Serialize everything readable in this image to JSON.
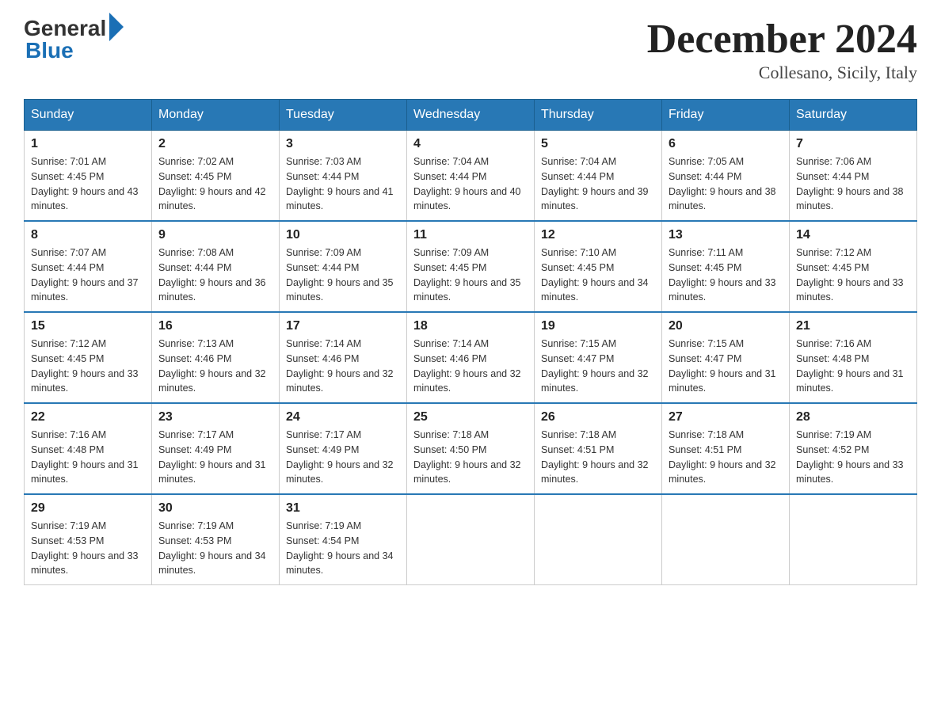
{
  "header": {
    "logo_general": "General",
    "logo_blue": "Blue",
    "month_title": "December 2024",
    "location": "Collesano, Sicily, Italy"
  },
  "days_of_week": [
    "Sunday",
    "Monday",
    "Tuesday",
    "Wednesday",
    "Thursday",
    "Friday",
    "Saturday"
  ],
  "weeks": [
    [
      {
        "day": "1",
        "sunrise": "7:01 AM",
        "sunset": "4:45 PM",
        "daylight": "9 hours and 43 minutes."
      },
      {
        "day": "2",
        "sunrise": "7:02 AM",
        "sunset": "4:45 PM",
        "daylight": "9 hours and 42 minutes."
      },
      {
        "day": "3",
        "sunrise": "7:03 AM",
        "sunset": "4:44 PM",
        "daylight": "9 hours and 41 minutes."
      },
      {
        "day": "4",
        "sunrise": "7:04 AM",
        "sunset": "4:44 PM",
        "daylight": "9 hours and 40 minutes."
      },
      {
        "day": "5",
        "sunrise": "7:04 AM",
        "sunset": "4:44 PM",
        "daylight": "9 hours and 39 minutes."
      },
      {
        "day": "6",
        "sunrise": "7:05 AM",
        "sunset": "4:44 PM",
        "daylight": "9 hours and 38 minutes."
      },
      {
        "day": "7",
        "sunrise": "7:06 AM",
        "sunset": "4:44 PM",
        "daylight": "9 hours and 38 minutes."
      }
    ],
    [
      {
        "day": "8",
        "sunrise": "7:07 AM",
        "sunset": "4:44 PM",
        "daylight": "9 hours and 37 minutes."
      },
      {
        "day": "9",
        "sunrise": "7:08 AM",
        "sunset": "4:44 PM",
        "daylight": "9 hours and 36 minutes."
      },
      {
        "day": "10",
        "sunrise": "7:09 AM",
        "sunset": "4:44 PM",
        "daylight": "9 hours and 35 minutes."
      },
      {
        "day": "11",
        "sunrise": "7:09 AM",
        "sunset": "4:45 PM",
        "daylight": "9 hours and 35 minutes."
      },
      {
        "day": "12",
        "sunrise": "7:10 AM",
        "sunset": "4:45 PM",
        "daylight": "9 hours and 34 minutes."
      },
      {
        "day": "13",
        "sunrise": "7:11 AM",
        "sunset": "4:45 PM",
        "daylight": "9 hours and 33 minutes."
      },
      {
        "day": "14",
        "sunrise": "7:12 AM",
        "sunset": "4:45 PM",
        "daylight": "9 hours and 33 minutes."
      }
    ],
    [
      {
        "day": "15",
        "sunrise": "7:12 AM",
        "sunset": "4:45 PM",
        "daylight": "9 hours and 33 minutes."
      },
      {
        "day": "16",
        "sunrise": "7:13 AM",
        "sunset": "4:46 PM",
        "daylight": "9 hours and 32 minutes."
      },
      {
        "day": "17",
        "sunrise": "7:14 AM",
        "sunset": "4:46 PM",
        "daylight": "9 hours and 32 minutes."
      },
      {
        "day": "18",
        "sunrise": "7:14 AM",
        "sunset": "4:46 PM",
        "daylight": "9 hours and 32 minutes."
      },
      {
        "day": "19",
        "sunrise": "7:15 AM",
        "sunset": "4:47 PM",
        "daylight": "9 hours and 32 minutes."
      },
      {
        "day": "20",
        "sunrise": "7:15 AM",
        "sunset": "4:47 PM",
        "daylight": "9 hours and 31 minutes."
      },
      {
        "day": "21",
        "sunrise": "7:16 AM",
        "sunset": "4:48 PM",
        "daylight": "9 hours and 31 minutes."
      }
    ],
    [
      {
        "day": "22",
        "sunrise": "7:16 AM",
        "sunset": "4:48 PM",
        "daylight": "9 hours and 31 minutes."
      },
      {
        "day": "23",
        "sunrise": "7:17 AM",
        "sunset": "4:49 PM",
        "daylight": "9 hours and 31 minutes."
      },
      {
        "day": "24",
        "sunrise": "7:17 AM",
        "sunset": "4:49 PM",
        "daylight": "9 hours and 32 minutes."
      },
      {
        "day": "25",
        "sunrise": "7:18 AM",
        "sunset": "4:50 PM",
        "daylight": "9 hours and 32 minutes."
      },
      {
        "day": "26",
        "sunrise": "7:18 AM",
        "sunset": "4:51 PM",
        "daylight": "9 hours and 32 minutes."
      },
      {
        "day": "27",
        "sunrise": "7:18 AM",
        "sunset": "4:51 PM",
        "daylight": "9 hours and 32 minutes."
      },
      {
        "day": "28",
        "sunrise": "7:19 AM",
        "sunset": "4:52 PM",
        "daylight": "9 hours and 33 minutes."
      }
    ],
    [
      {
        "day": "29",
        "sunrise": "7:19 AM",
        "sunset": "4:53 PM",
        "daylight": "9 hours and 33 minutes."
      },
      {
        "day": "30",
        "sunrise": "7:19 AM",
        "sunset": "4:53 PM",
        "daylight": "9 hours and 34 minutes."
      },
      {
        "day": "31",
        "sunrise": "7:19 AM",
        "sunset": "4:54 PM",
        "daylight": "9 hours and 34 minutes."
      },
      null,
      null,
      null,
      null
    ]
  ]
}
